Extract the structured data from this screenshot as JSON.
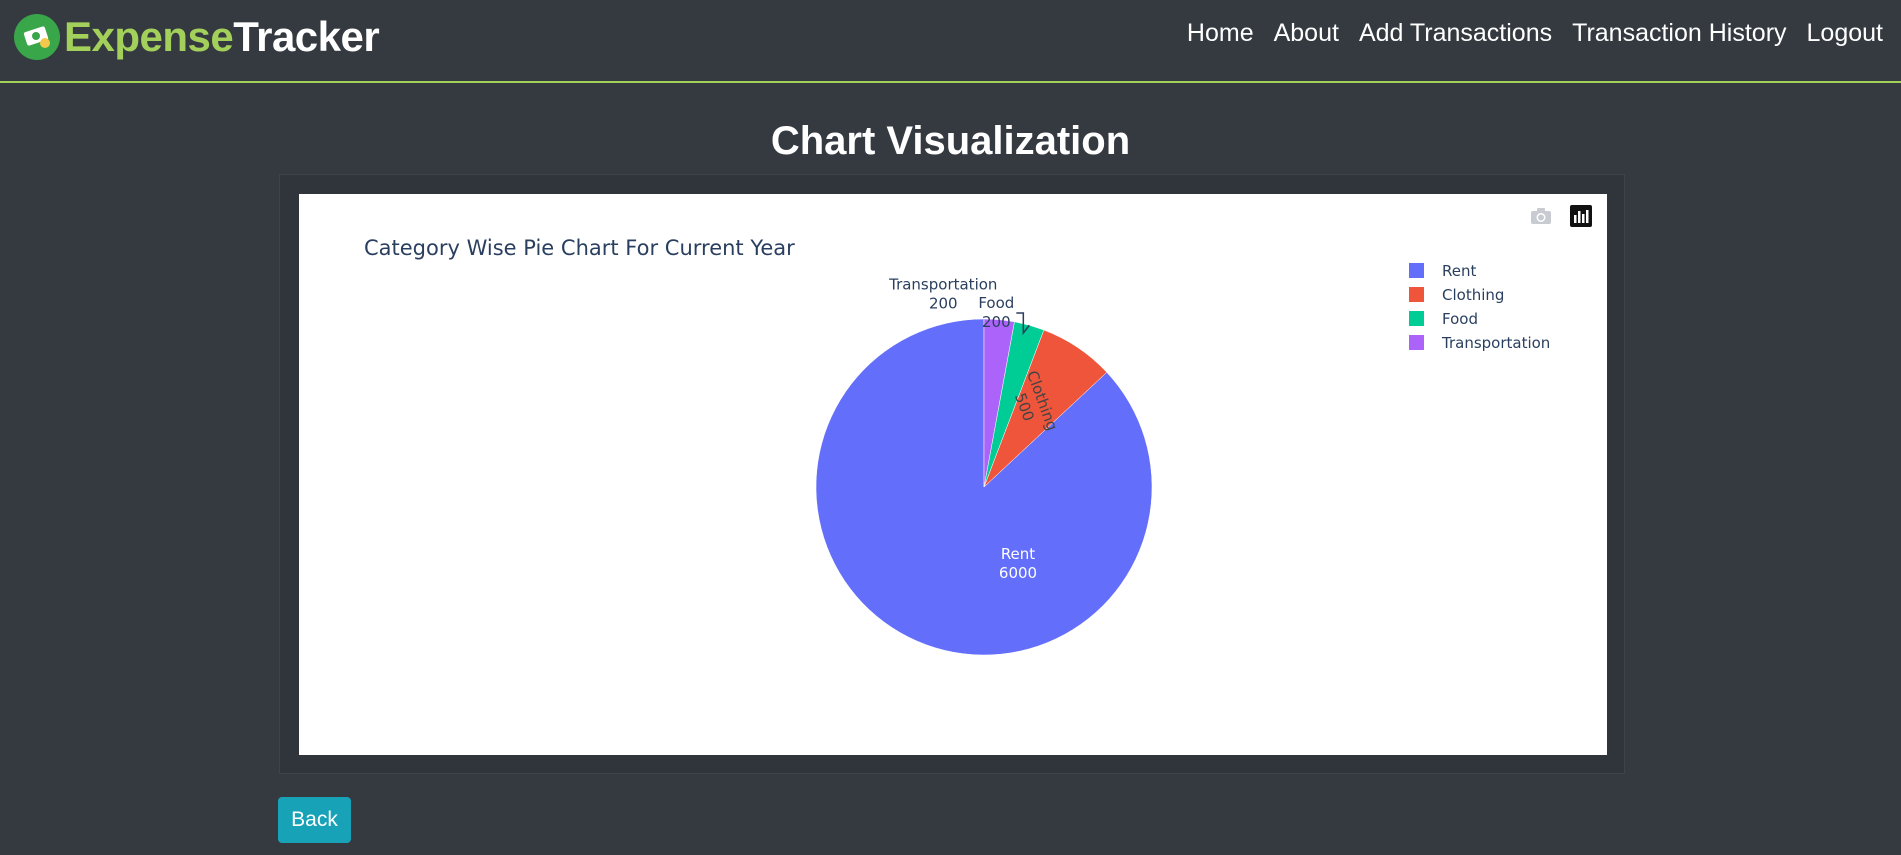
{
  "brand": {
    "part1": "Expense",
    "part2": "Tracker",
    "colors": {
      "accent": "#a3d05a",
      "logo_bg": "#3aa64a"
    }
  },
  "nav": {
    "home": "Home",
    "about": "About",
    "add_transactions": "Add Transactions",
    "transaction_history": "Transaction History",
    "logout": "Logout"
  },
  "page": {
    "title": "Chart Visualization"
  },
  "modebar": {
    "icons": [
      "camera-icon",
      "plotly-logo-icon"
    ]
  },
  "chart_data": {
    "type": "pie",
    "title": "Category Wise Pie Chart For Current Year",
    "categories": [
      "Rent",
      "Clothing",
      "Food",
      "Transportation"
    ],
    "values": [
      6000,
      500,
      200,
      200
    ],
    "colors": [
      "#636efa",
      "#ef553b",
      "#00cc96",
      "#ab63fa"
    ],
    "labels": [
      "Rent",
      "Clothing",
      "Food",
      "Transportation"
    ],
    "legend": "right",
    "direction": "clockwise",
    "start": "top"
  },
  "back_button": {
    "label": "Back",
    "color": "#17a2b8"
  }
}
